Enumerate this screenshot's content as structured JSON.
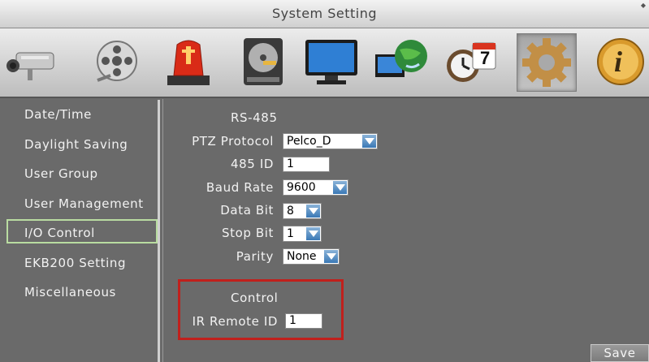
{
  "window": {
    "title": "System Setting",
    "corner_glyph": "◆"
  },
  "toolbar": {
    "icons": [
      {
        "name": "camera-icon"
      },
      {
        "name": "film-reel-icon"
      },
      {
        "name": "alarm-light-icon"
      },
      {
        "name": "hard-disk-icon"
      },
      {
        "name": "monitor-icon"
      },
      {
        "name": "network-globe-icon"
      },
      {
        "name": "schedule-clock-calendar-icon"
      },
      {
        "name": "system-gear-icon",
        "active": true
      },
      {
        "name": "info-icon"
      }
    ],
    "calendar_day": "7",
    "info_glyph": "i"
  },
  "sidebar": {
    "items": [
      {
        "label": "Date/Time"
      },
      {
        "label": "Daylight Saving"
      },
      {
        "label": "User Group"
      },
      {
        "label": "User Management"
      },
      {
        "label": "I/O Control",
        "active": true
      },
      {
        "label": "EKB200 Setting"
      },
      {
        "label": "Miscellaneous"
      }
    ]
  },
  "rs485": {
    "heading": "RS-485",
    "ptz_protocol": {
      "label": "PTZ Protocol",
      "value": "Pelco_D"
    },
    "id485": {
      "label": "485 ID",
      "value": "1"
    },
    "baud_rate": {
      "label": "Baud Rate",
      "value": "9600"
    },
    "data_bit": {
      "label": "Data Bit",
      "value": "8"
    },
    "stop_bit": {
      "label": "Stop Bit",
      "value": "1"
    },
    "parity": {
      "label": "Parity",
      "value": "None"
    }
  },
  "control": {
    "heading": "Control",
    "ir_remote_id": {
      "label": "IR Remote ID",
      "value": "1"
    }
  },
  "actions": {
    "save_label": "Save"
  },
  "colors": {
    "highlight_border": "#c0201c",
    "active_menu_border": "#b9dca1",
    "dropdown_arrow": "#3b79b6"
  }
}
